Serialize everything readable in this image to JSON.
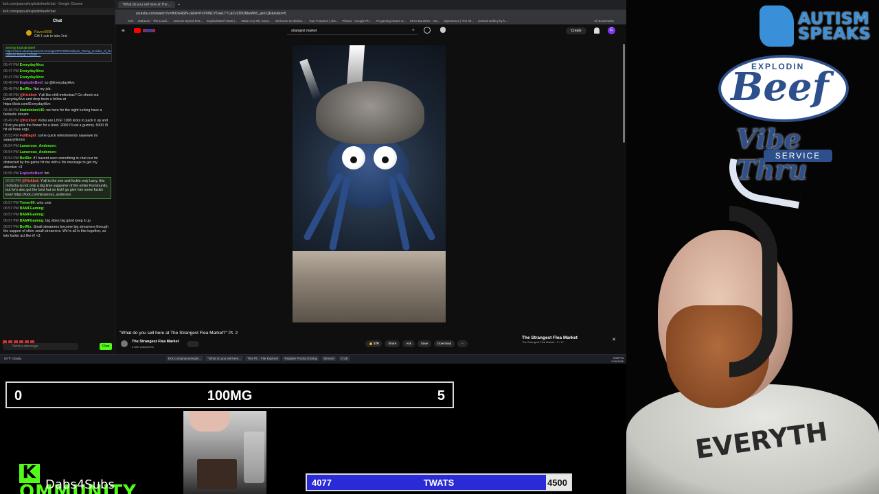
{
  "chat": {
    "window_title": "kick.com/popout/explodinbeef/chat - Google Chrome",
    "url": "kick.com/popout/explodinbeef/chat",
    "header": "Chat",
    "gift_user": "Raven0898",
    "gift_text": "Gift 1 sub to take 2nd",
    "pinned_by": "Sent by ExplodinBeef",
    "pinned_link": "https://store.steampowered.com/app/3731800/Valkyrie_Rising_Hordes_of_Ragnark_Demo/ Valkyrie Rising: Hordes ...",
    "messages": [
      {
        "time": "06:47 PM",
        "user": "EverydayAlvx:",
        "text": "",
        "color": "#53fc18"
      },
      {
        "time": "06:47 PM",
        "user": "EverydayAlvx:",
        "text": "",
        "color": "#53fc18"
      },
      {
        "time": "06:47 PM",
        "user": "EverydayAlvx:",
        "text": "",
        "color": "#53fc18"
      },
      {
        "time": "06:48 PM",
        "user": "ExplodinBeef:",
        "text": "so @EverydayAlvx",
        "color": "#c45bff"
      },
      {
        "time": "06:48 PM",
        "user": "BotRix:",
        "text": "Not my job.",
        "color": "#53fc18"
      },
      {
        "time": "06:48 PM",
        "user": "@Kickbot:",
        "text": "Y'all like chill mofuckas? Go check out EverydayAlvx and drop them a follow at https://kick.com/EverydayAlvx",
        "color": "#ff5c5c"
      },
      {
        "time": "06:48 PM",
        "user": "kiwiminion145:",
        "text": "we here for the night lurking have a fantastic stream",
        "color": "#53fc18"
      },
      {
        "time": "06:49 PM",
        "user": "@Kickbot:",
        "text": "Kicks are LIVE! 1000 kicks to pack it up and I'll let you pick the flower for a bowl. 2000 I'll eat a gummy. 5000 I'll hit all three ergs.",
        "color": "#ff5c5c"
      },
      {
        "time": "06:53 PM",
        "user": "FullBagill:",
        "text": "some quick refreshments nawwww im saaayyllinnnn",
        "color": "#ff5c5c"
      },
      {
        "time": "06:54 PM",
        "user": "Larserous_Anderson:",
        "text": "",
        "color": "#53fc18"
      },
      {
        "time": "06:54 PM",
        "user": "Larserous_Anderson:",
        "text": "",
        "color": "#53fc18"
      },
      {
        "time": "06:54 PM",
        "user": "BotRix:",
        "text": "if I havent seen something in chat cuz im distracted by the game hit me with a !tts message to get my attention <3",
        "color": "#53fc18"
      },
      {
        "time": "06:55 PM",
        "user": "ExplodinBeef:",
        "text": "lim",
        "color": "#c45bff"
      },
      {
        "time": "06:55 PM",
        "user": "@Kickbot:",
        "text": "Y'all is the one and fuckin only Larry, this mofucka is not only a big time supporter of the entire Kommunity, but he's also got the best hat on kick! go give him some fuckin love! https://kick.com/larserous_anderson",
        "color": "#ff5c5c",
        "highlight": true
      },
      {
        "time": "06:57 PM",
        "user": "Trener99:",
        "text": "untz untz",
        "color": "#53fc18"
      },
      {
        "time": "06:57 PM",
        "user": "BAMFGaming:",
        "text": "",
        "color": "#53fc18"
      },
      {
        "time": "06:57 PM",
        "user": "BAMFGaming:",
        "text": "",
        "color": "#53fc18"
      },
      {
        "time": "06:57 PM",
        "user": "BAMFGaming:",
        "text": "big vibes big grind keep it up",
        "color": "#53fc18"
      },
      {
        "time": "06:57 PM",
        "user": "BotRix:",
        "text": "Small streamers become big streamers through the support of other small streamers. We're all in this together, so lets fuckin act like it! <3",
        "color": "#53fc18"
      }
    ],
    "input_placeholder": "Send a message",
    "send_label": "Chat"
  },
  "browser": {
    "tab_title": "\"What do you sell here at The ...",
    "url": "youtube.com/watch?v=9hUteRj9N-c&list=PLP0INCYOaeLTYl,&CvZD92MwMN5_gerLQR&index=5",
    "bookmarks": [
      "Kick",
      "Stabauer - The Leadi...",
      "Internet Speed Test...",
      "ExplodinBeef Stats |...",
      "Make Any Mic Soun...",
      "Welcome to Okiebo...",
      "Your Porpoise | clot...",
      "Photos - Google Ph...",
      "Pe gaming issues w...",
      "KICK Bounties - ma...",
      "Mylestones | The Isl...",
      "Limited Gallery by k..."
    ],
    "all_bookmarks": "All Bookmarks",
    "search_value": "strangest market",
    "create_label": "Create",
    "avatar_letter": "E",
    "video_title": "\"What do you sell here at The Strangest Flea Market?\" Pt. 2",
    "channel": "The Strangest Flea Market",
    "subscribers": "3.66K subscribers",
    "likes": "179",
    "share_label": "Share",
    "ask_label": "Ask",
    "save_label": "Save",
    "download_label": "Download",
    "side_title": "The Strangest Flea Market",
    "side_sub": "The Strangest Flea Market - 5 / 17"
  },
  "taskbar": {
    "weather": "54°F Cloudy",
    "items": [
      "kick.com/popout/explo...",
      "\"What do you sell here...",
      "This PC - File Explorer",
      "Register Product Dialog",
      "Streamr",
      "ICUE"
    ],
    "time": "6:58 PM",
    "date": "2/16/2026"
  },
  "overlay": {
    "counter_left": "0",
    "counter_center": "100MG",
    "counter_right": "5",
    "kommunity_main": "OMMUNITY",
    "kommunity_k": "K",
    "kommunity_sub": "Dabs4Subs",
    "goal_current": "4077",
    "goal_label": "TWATS",
    "goal_target": "4500",
    "goal_progress": 0.906,
    "autism_text": "AUTISM SPEAKS",
    "beef_top": "EXPLODIN",
    "beef_main": "Beef",
    "vibe": "Vibe Thru",
    "service": "SERVICE",
    "shirt_text": "EVERYTH"
  },
  "colors": {
    "kick_green": "#53fc18",
    "goal_blue": "#2a2bd6",
    "youtube_red": "#ff0000",
    "logo_blue": "#2d4f8c"
  }
}
